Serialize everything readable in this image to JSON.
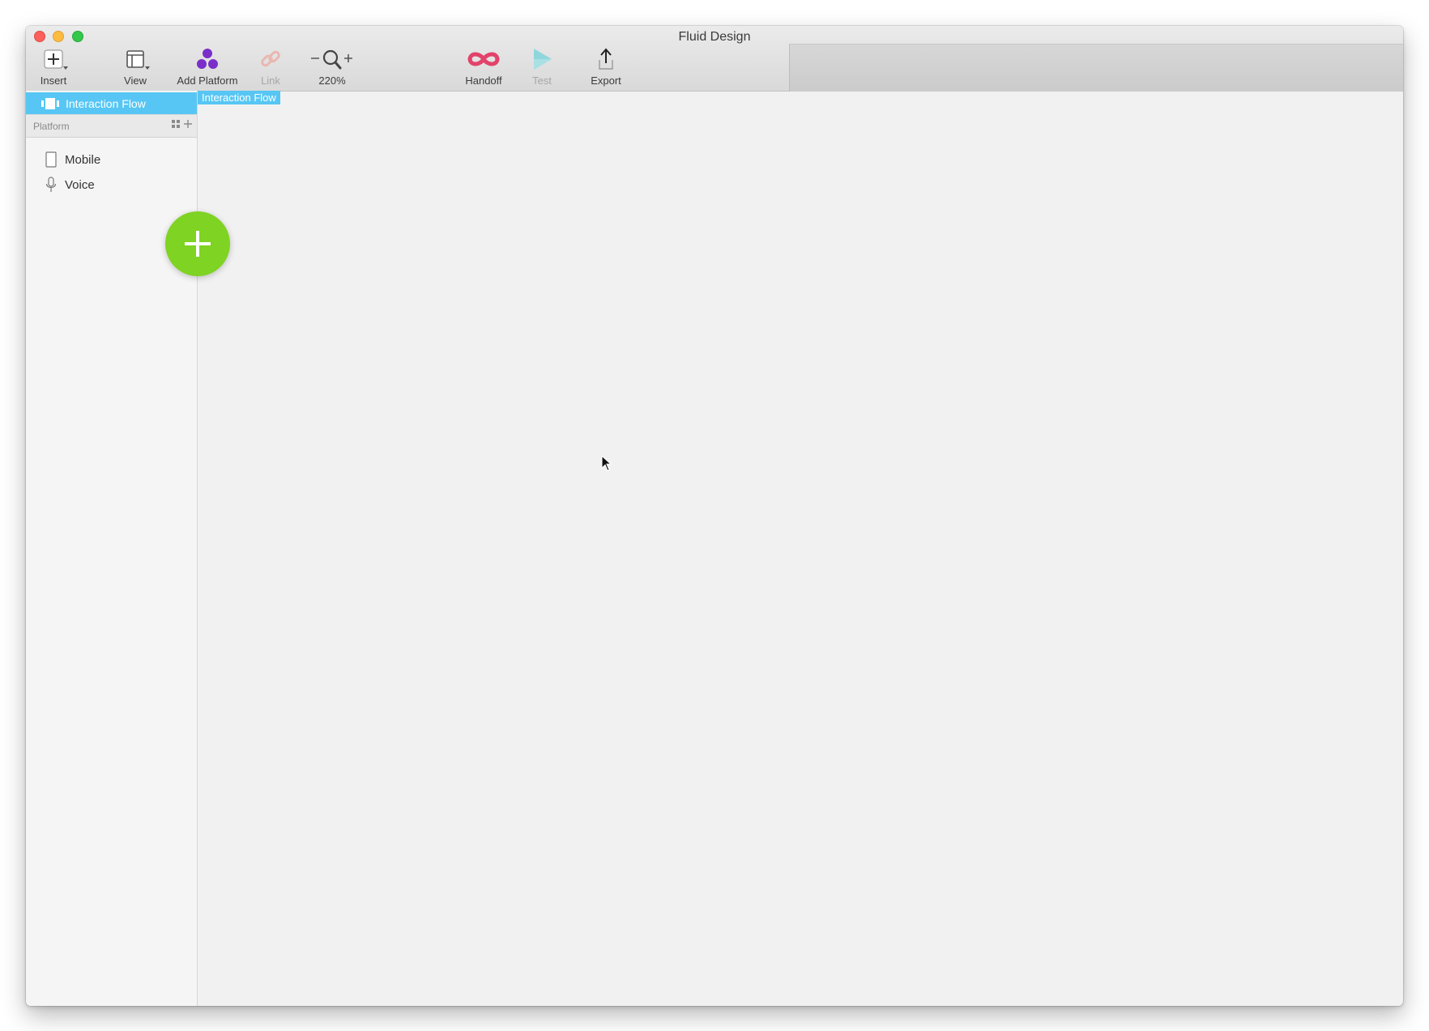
{
  "window": {
    "title": "Fluid Design"
  },
  "toolbar": {
    "insert_label": "Insert",
    "view_label": "View",
    "add_platform_label": "Add Platform",
    "link_label": "Link",
    "zoom_label": "220%",
    "handoff_label": "Handoff",
    "test_label": "Test",
    "export_label": "Export"
  },
  "sidebar": {
    "selected_item": "Interaction Flow",
    "section_title": "Platform",
    "items": [
      {
        "label": "Mobile",
        "icon": "phone-icon"
      },
      {
        "label": "Voice",
        "icon": "microphone-icon"
      }
    ]
  },
  "canvas": {
    "tag_label": "Interaction Flow"
  },
  "colors": {
    "accent_blue": "#57c6f4",
    "fab_green": "#7fd322",
    "add_platform_purple": "#7b2fc9",
    "handoff_red": "#e2426b",
    "test_teal": "#8fd6dc",
    "link_pink": "#e9b8b0"
  }
}
